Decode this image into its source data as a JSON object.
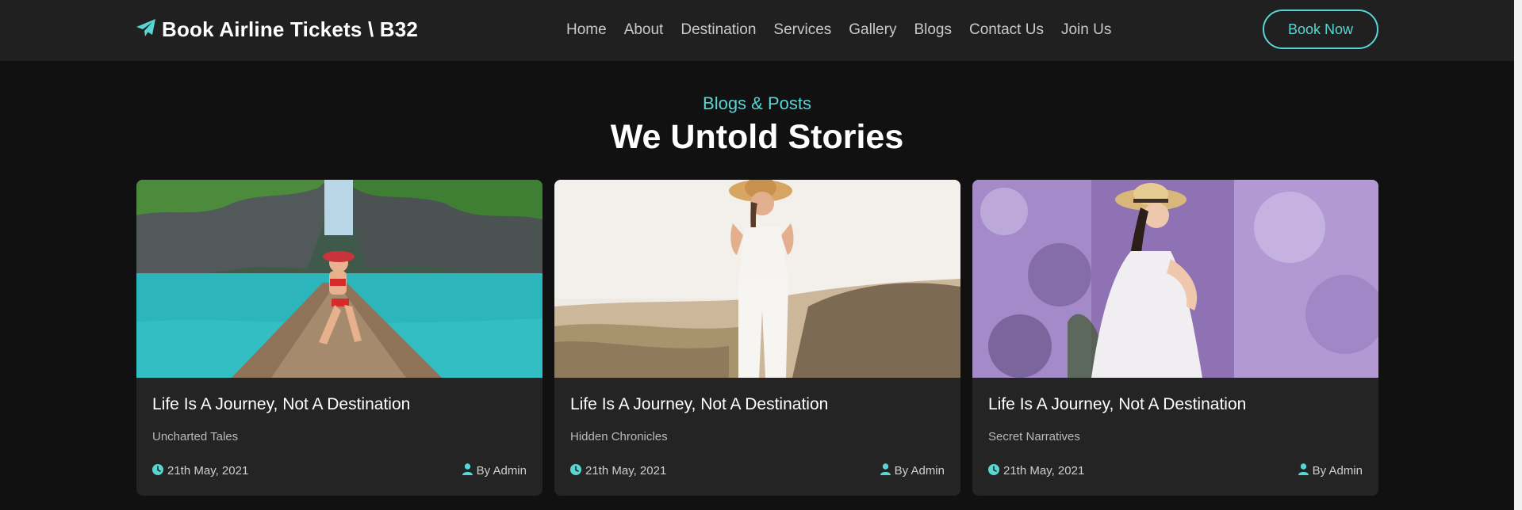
{
  "brand": {
    "name": "Book Airline Tickets \\ B32",
    "icon": "paper-plane-icon",
    "icon_color": "#58d6d3"
  },
  "nav": {
    "items": [
      "Home",
      "About",
      "Destination",
      "Services",
      "Gallery",
      "Blogs",
      "Contact Us",
      "Join Us"
    ],
    "cta_label": "Book Now"
  },
  "section": {
    "subtitle": "Blogs & Posts",
    "title": "We Untold Stories"
  },
  "cards": [
    {
      "title": "Life Is A Journey, Not A Destination",
      "subtitle": "Uncharted Tales",
      "date": "21th May, 2021",
      "author": "By Admin",
      "image": "woman-on-boat-lagoon-photo"
    },
    {
      "title": "Life Is A Journey, Not A Destination",
      "subtitle": "Hidden Chronicles",
      "date": "21th May, 2021",
      "author": "By Admin",
      "image": "woman-in-white-on-dunes-photo"
    },
    {
      "title": "Life Is A Journey, Not A Destination",
      "subtitle": "Secret Narratives",
      "date": "21th May, 2021",
      "author": "By Admin",
      "image": "woman-in-purple-flowers-photo"
    }
  ],
  "colors": {
    "accent": "#58d6d3",
    "background": "#111111",
    "navbar": "#202020",
    "card": "#242424"
  }
}
